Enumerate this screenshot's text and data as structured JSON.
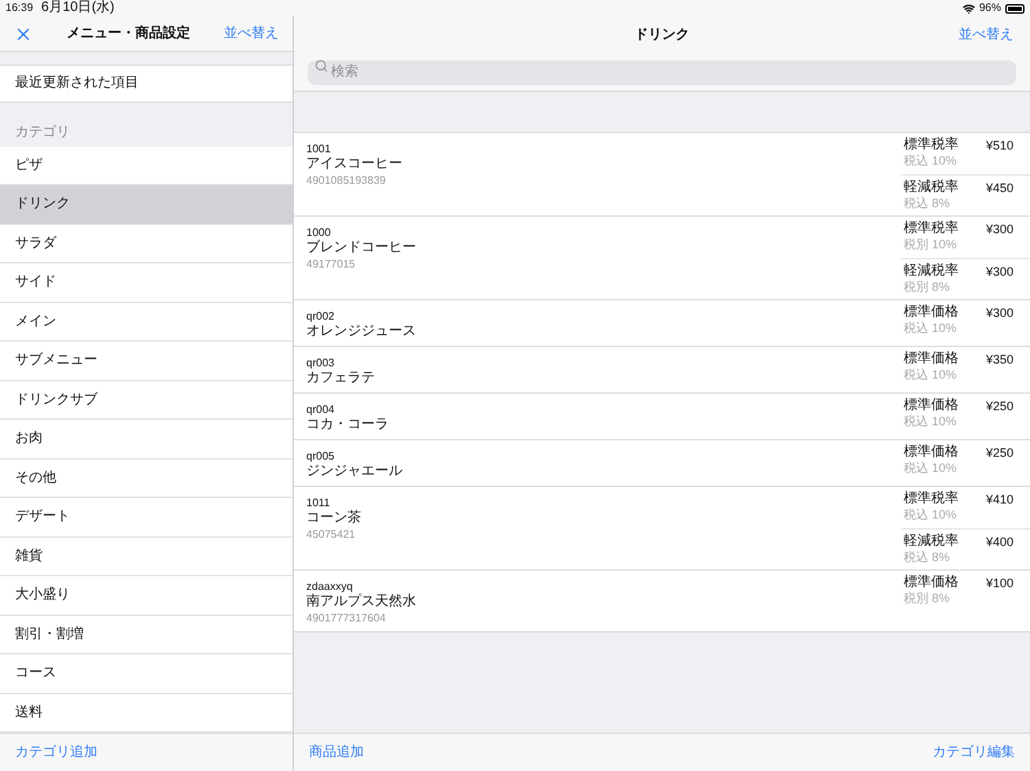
{
  "status_bar": {
    "time": "16:39",
    "date": "6月10日(水)",
    "battery": "96%"
  },
  "sidebar": {
    "title": "メニュー・商品設定",
    "sort": "並べ替え",
    "recent": "最近更新された項目",
    "section": "カテゴリ",
    "items": [
      {
        "label": "ピザ",
        "selected": false
      },
      {
        "label": "ドリンク",
        "selected": true
      },
      {
        "label": "サラダ",
        "selected": false
      },
      {
        "label": "サイド",
        "selected": false
      },
      {
        "label": "メイン",
        "selected": false
      },
      {
        "label": "サブメニュー",
        "selected": false
      },
      {
        "label": "ドリンクサブ",
        "selected": false
      },
      {
        "label": "お肉",
        "selected": false
      },
      {
        "label": "その他",
        "selected": false
      },
      {
        "label": "デザート",
        "selected": false
      },
      {
        "label": "雑貨",
        "selected": false
      },
      {
        "label": "大小盛り",
        "selected": false
      },
      {
        "label": "割引・割増",
        "selected": false
      },
      {
        "label": "コース",
        "selected": false
      },
      {
        "label": "送料",
        "selected": false
      }
    ],
    "footer": "カテゴリ追加"
  },
  "main": {
    "title": "ドリンク",
    "sort": "並べ替え",
    "search": {
      "placeholder": "検索"
    },
    "products": [
      {
        "code": "1001",
        "name": "アイスコーヒー",
        "barcode": "4901085193839",
        "prices": [
          {
            "label": "標準税率",
            "note": "税込 10%",
            "price": "¥510"
          },
          {
            "label": "軽減税率",
            "note": "税込 8%",
            "price": "¥450"
          }
        ]
      },
      {
        "code": "1000",
        "name": "ブレンドコーヒー",
        "barcode": "49177015",
        "prices": [
          {
            "label": "標準税率",
            "note": "税別 10%",
            "price": "¥300"
          },
          {
            "label": "軽減税率",
            "note": "税別 8%",
            "price": "¥300"
          }
        ]
      },
      {
        "code": "qr002",
        "name": "オレンジジュース",
        "prices": [
          {
            "label": "標準価格",
            "note": "税込 10%",
            "price": "¥300"
          }
        ]
      },
      {
        "code": "qr003",
        "name": "カフェラテ",
        "prices": [
          {
            "label": "標準価格",
            "note": "税込 10%",
            "price": "¥350"
          }
        ]
      },
      {
        "code": "qr004",
        "name": "コカ・コーラ",
        "prices": [
          {
            "label": "標準価格",
            "note": "税込 10%",
            "price": "¥250"
          }
        ]
      },
      {
        "code": "qr005",
        "name": "ジンジャエール",
        "prices": [
          {
            "label": "標準価格",
            "note": "税込 10%",
            "price": "¥250"
          }
        ]
      },
      {
        "code": "1011",
        "name": "コーン茶",
        "barcode": "45075421",
        "prices": [
          {
            "label": "標準税率",
            "note": "税込 10%",
            "price": "¥410"
          },
          {
            "label": "軽減税率",
            "note": "税込 8%",
            "price": "¥400"
          }
        ]
      },
      {
        "code": "zdaaxxyq",
        "name": "南アルプス天然水",
        "barcode": "4901777317604",
        "prices": [
          {
            "label": "標準価格",
            "note": "税別 8%",
            "price": "¥100"
          }
        ]
      }
    ],
    "footer_left": "商品追加",
    "footer_right": "カテゴリ編集"
  }
}
